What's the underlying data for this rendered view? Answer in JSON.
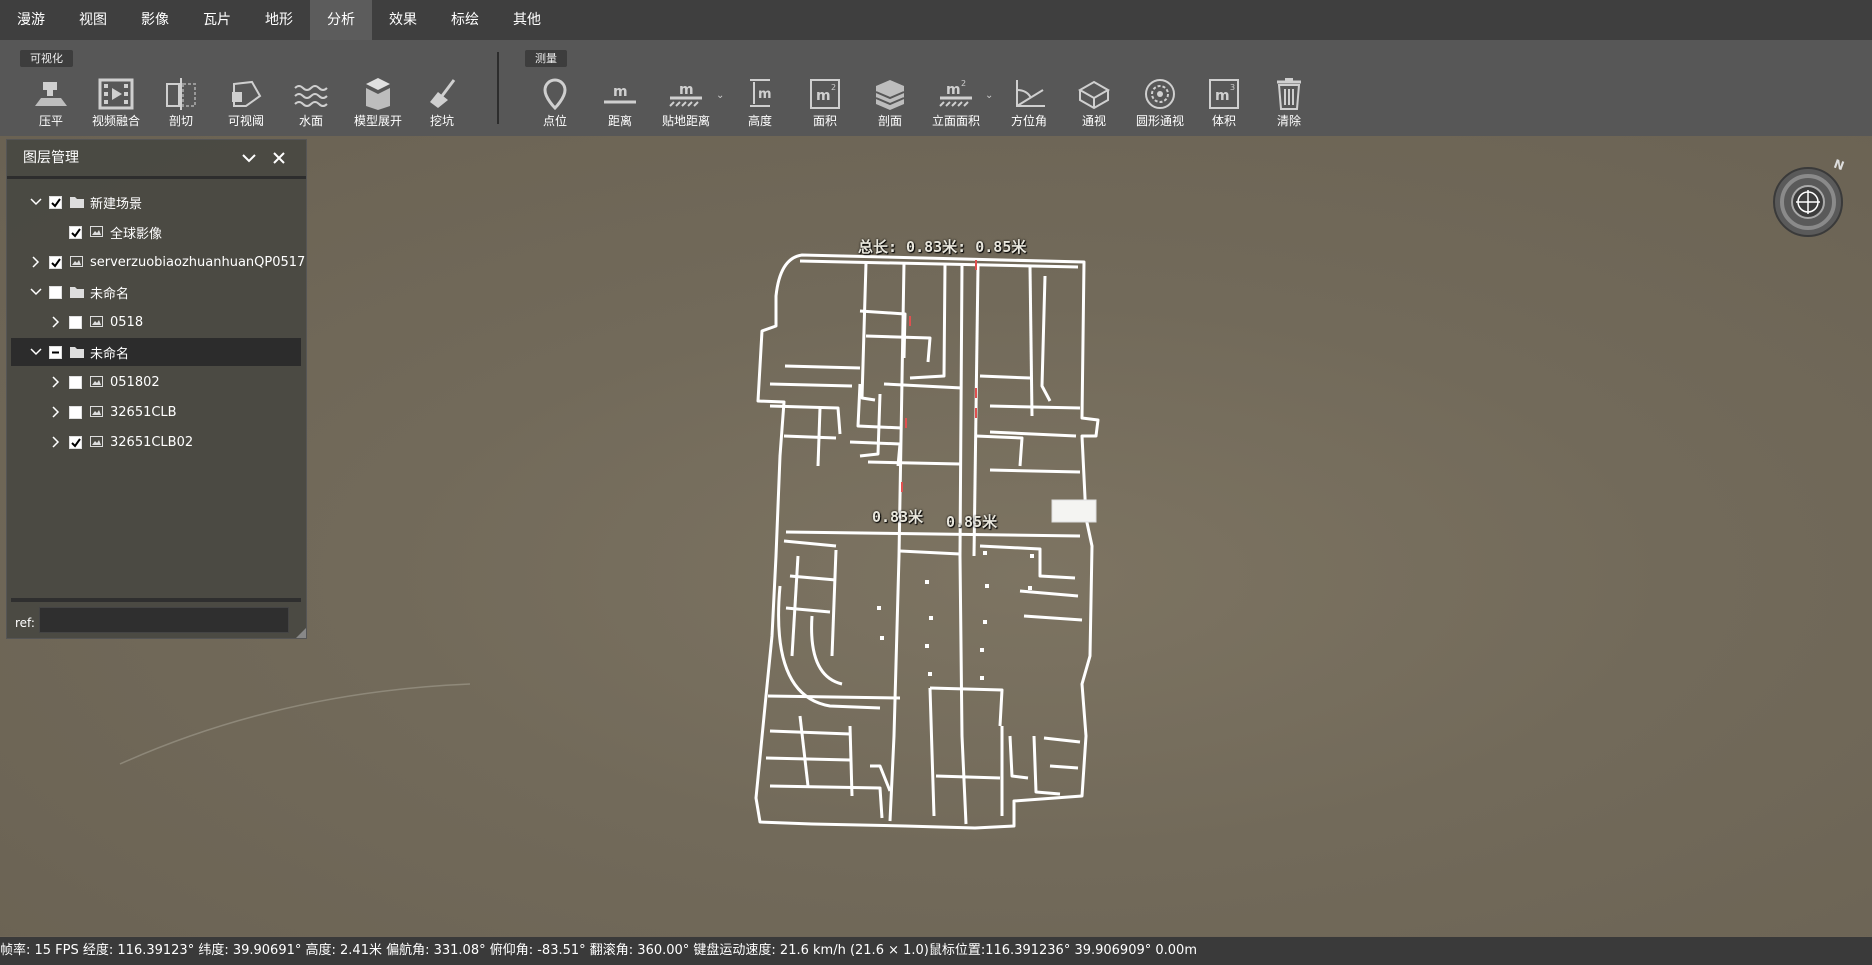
{
  "menu": {
    "tabs": [
      "漫游",
      "视图",
      "影像",
      "瓦片",
      "地形",
      "分析",
      "效果",
      "标绘",
      "其他"
    ],
    "active": "分析"
  },
  "ribbon": {
    "group_visual": "可视化",
    "group_measure": "测量",
    "visual_tools": [
      "压平",
      "视频融合",
      "剖切",
      "可视阈",
      "水面",
      "模型展开",
      "挖坑"
    ],
    "measure_tools": [
      "点位",
      "距离",
      "贴地距离",
      "高度",
      "面积",
      "剖面",
      "立面面积",
      "方位角",
      "通视",
      "圆形通视",
      "体积",
      "清除"
    ]
  },
  "layer_panel": {
    "title": "图层管理",
    "items": [
      {
        "label": "新建场景",
        "checked": "checked"
      },
      {
        "label": "全球影像",
        "checked": "checked"
      },
      {
        "label": "serverzuobiaozhuanhuanQP0517",
        "checked": "checked"
      },
      {
        "label": "未命名",
        "checked": "unchecked"
      },
      {
        "label": "0518",
        "checked": "unchecked"
      },
      {
        "label": "未命名",
        "checked": "partial"
      },
      {
        "label": "051802",
        "checked": "unchecked"
      },
      {
        "label": "32651CLB",
        "checked": "unchecked"
      },
      {
        "label": "32651CLB02",
        "checked": "checked"
      }
    ],
    "ref_label": "ref:",
    "ref_value": ""
  },
  "measurements": {
    "total_label": "总长: 0.83米: 0.85米",
    "seg1": "0.83米",
    "seg2": "0.85米"
  },
  "compass": {
    "north": "N"
  },
  "status": {
    "text": "帧率: 15 FPS 经度: 116.39123° 纬度: 39.90691° 高度: 2.41米 偏航角: 331.08° 俯仰角: -83.51° 翻滚角: 360.00° 键盘运动速度: 21.6 km/h (21.6 × 1.0)鼠标位置:116.391236° 39.906909° 0.00m"
  }
}
